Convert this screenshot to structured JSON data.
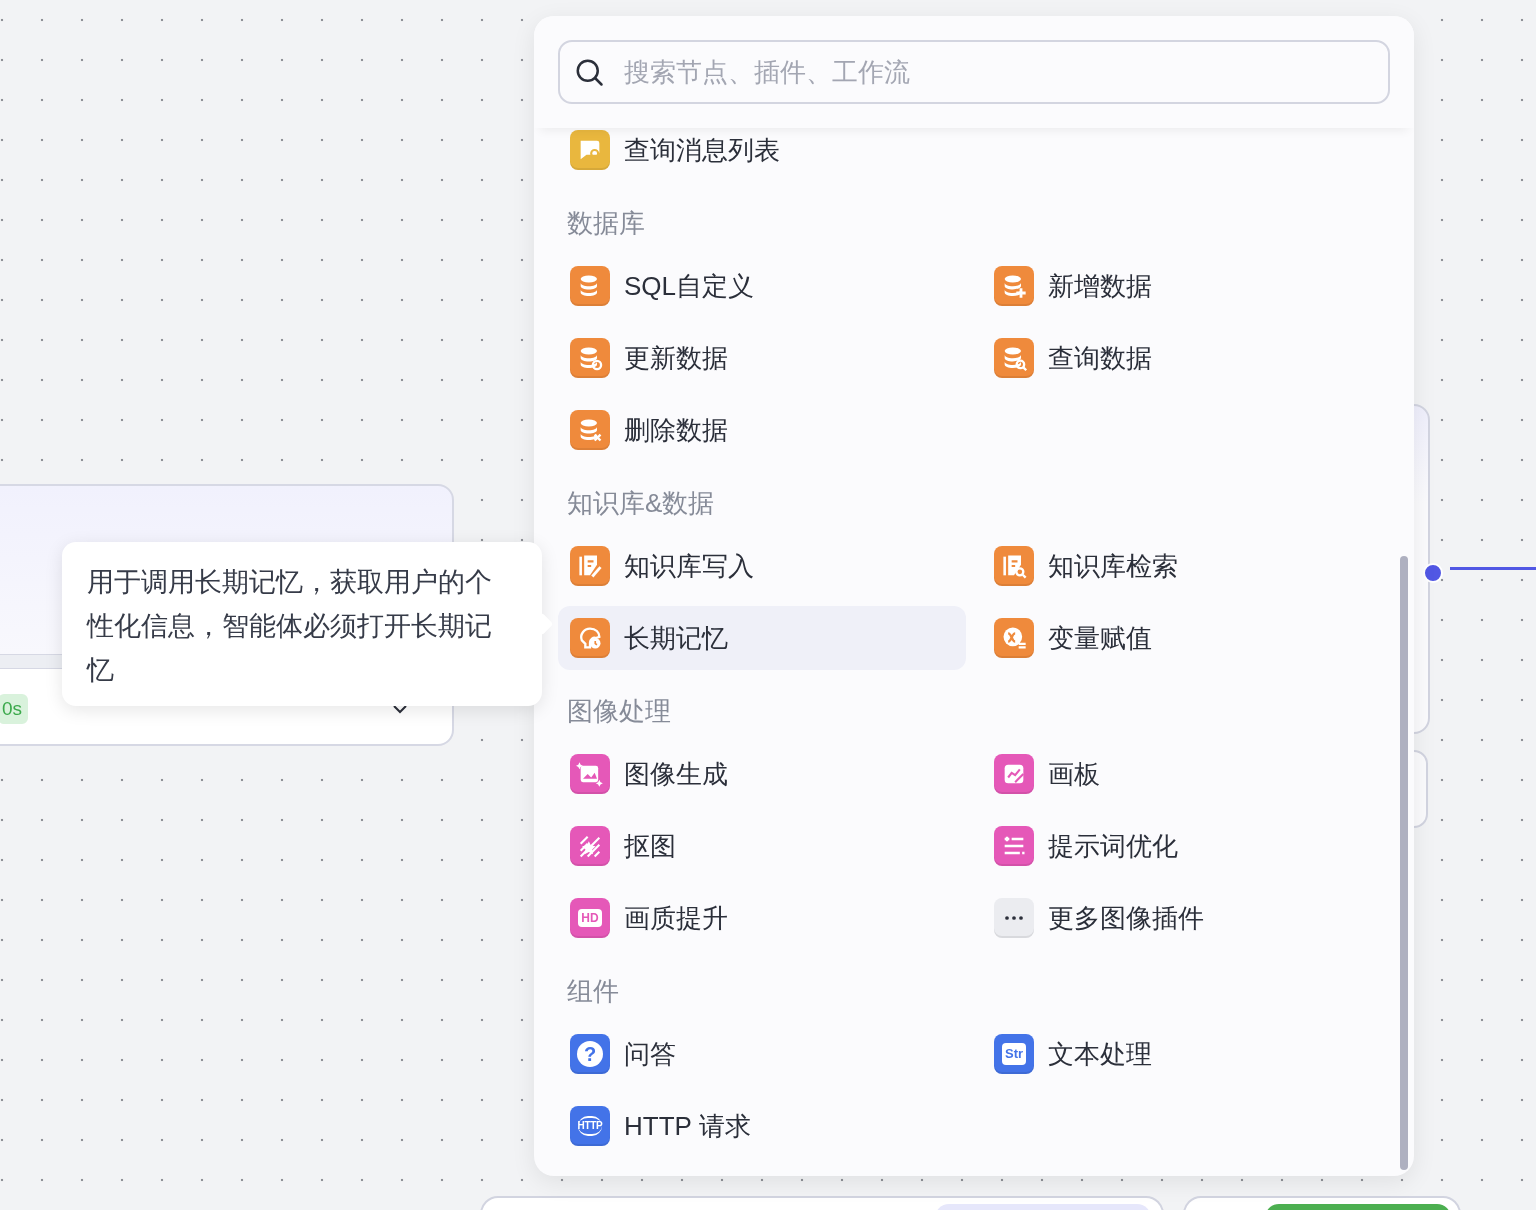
{
  "canvas": {
    "left_node": {
      "badge": "0s"
    }
  },
  "tooltip": {
    "text": "用于调用长期记忆，获取用户的个性化信息，智能体必须打开长期记忆"
  },
  "node_panel": {
    "search": {
      "placeholder": "搜索节点、插件、工作流"
    },
    "sections": [
      {
        "items": [
          {
            "label": "查询消息列表",
            "kind": "chat-search",
            "color": "#e9b73e",
            "selected": false
          }
        ]
      },
      {
        "title": "数据库",
        "items": [
          {
            "label": "SQL自定义",
            "kind": "database",
            "color": "#ef8a3c",
            "selected": false
          },
          {
            "label": "新增数据",
            "kind": "database-add",
            "color": "#ef8a3c",
            "selected": false
          },
          {
            "label": "更新数据",
            "kind": "database-sync",
            "color": "#ef8a3c",
            "selected": false
          },
          {
            "label": "查询数据",
            "kind": "database-search",
            "color": "#ef8a3c",
            "selected": false
          },
          {
            "label": "删除数据",
            "kind": "database-delete",
            "color": "#ef8a3c",
            "selected": false
          }
        ]
      },
      {
        "title": "知识库&数据",
        "items": [
          {
            "label": "知识库写入",
            "kind": "doc-edit",
            "color": "#ef8a3c",
            "selected": false
          },
          {
            "label": "知识库检索",
            "kind": "doc-search",
            "color": "#ef8a3c",
            "selected": false
          },
          {
            "label": "长期记忆",
            "kind": "memory",
            "color": "#ef8a3c",
            "selected": true
          },
          {
            "label": "变量赋值",
            "kind": "variable",
            "color": "#ef8a3c",
            "selected": false
          }
        ]
      },
      {
        "title": "图像处理",
        "items": [
          {
            "label": "图像生成",
            "kind": "image",
            "color": "#e558b8",
            "selected": false
          },
          {
            "label": "画板",
            "kind": "canvas",
            "color": "#e558b8",
            "selected": false
          },
          {
            "label": "抠图",
            "kind": "cutout",
            "color": "#e558b8",
            "selected": false
          },
          {
            "label": "提示词优化",
            "kind": "prompt",
            "color": "#e558b8",
            "selected": false
          },
          {
            "label": "画质提升",
            "kind": "hd",
            "icon_text": "HD",
            "color": "#e558b8",
            "selected": false
          },
          {
            "label": "更多图像插件",
            "kind": "more",
            "color": "#ebecf0",
            "selected": false
          }
        ]
      },
      {
        "title": "组件",
        "items": [
          {
            "label": "问答",
            "kind": "question",
            "icon_text": "?",
            "color": "#4373e8",
            "selected": false
          },
          {
            "label": "文本处理",
            "kind": "puzzle",
            "icon_text": "Str",
            "color": "#4373e8",
            "selected": false
          },
          {
            "label": "HTTP 请求",
            "kind": "globe",
            "icon_text": "HTTP",
            "color": "#4373e8",
            "selected": false
          }
        ]
      }
    ]
  }
}
